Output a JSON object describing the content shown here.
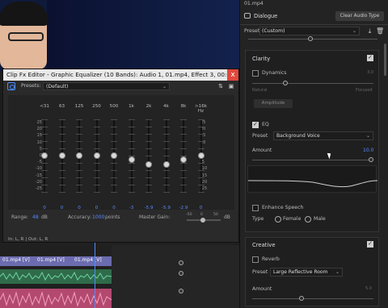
{
  "fx_editor": {
    "title": "Clip Fx Editor - Graphic Equalizer (10 Bands): Audio 1, 01.mp4, Effect 3, 00:00:10:18",
    "close_glyph": "x",
    "presets_label": "Presets:",
    "preset_value": "(Default)",
    "bands": [
      {
        "label": "<31",
        "value": "0",
        "gain_db": 0
      },
      {
        "label": "63",
        "value": "0",
        "gain_db": 0
      },
      {
        "label": "125",
        "value": "0",
        "gain_db": 0
      },
      {
        "label": "250",
        "value": "0",
        "gain_db": 0
      },
      {
        "label": "500",
        "value": "0",
        "gain_db": 0
      },
      {
        "label": "1k",
        "value": "-3",
        "gain_db": -3
      },
      {
        "label": "2k",
        "value": "-5.9",
        "gain_db": -5.9
      },
      {
        "label": "4k",
        "value": "-5.9",
        "gain_db": -5.9
      },
      {
        "label": "8k",
        "value": "-2.9",
        "gain_db": -2.9
      },
      {
        "label": ">16k Hz",
        "value": "0",
        "gain_db": 0
      }
    ],
    "scale_left": [
      "25",
      "20",
      "15",
      "10",
      "5",
      "0",
      "-5",
      "-10",
      "-15",
      "-20",
      "-25"
    ],
    "scale_right": [
      "25",
      "20",
      "15",
      "10",
      "5",
      "0",
      "-5",
      "-10",
      "-15",
      "-20",
      "-25"
    ],
    "range_label": "Range:",
    "range_value": "48",
    "range_unit": "dB",
    "accuracy_label": "Accuracy:",
    "accuracy_value": "1000",
    "accuracy_unit": "points",
    "master_gain_label": "Master Gain:",
    "master_gain_scale": [
      "-50",
      "0",
      "50"
    ],
    "master_gain_unit": "dB",
    "status": "In: L, R | Out: L, R"
  },
  "timeline": {
    "clips": [
      "01.mp4 [V]",
      "01.mp4 [V]",
      "01.mp4 [V]"
    ]
  },
  "essential_sound": {
    "file": "01.mp4",
    "type_label": "Dialogue",
    "clear_button": "Clear Audio Type",
    "preset_label": "Preset:",
    "preset_value": "(Custom)",
    "clarity": {
      "title": "Clarity",
      "dynamics_label": "Dynamics",
      "dynamics_value": "3.0",
      "natural_label": "Natural",
      "focused_label": "Focused",
      "amplitude_button": "Amplitude",
      "eq_label": "EQ",
      "eq_preset_label": "Preset",
      "eq_preset_value": "Background Voice",
      "amount_label": "Amount",
      "amount_value": "10.0",
      "enhance_label": "Enhance Speech",
      "type_label": "Type",
      "female_label": "Female",
      "male_label": "Male"
    },
    "creative": {
      "title": "Creative",
      "reverb_label": "Reverb",
      "preset_label": "Preset",
      "preset_value": "Large Reflective Room",
      "amount_label": "Amount",
      "amount_value": "5.0"
    }
  },
  "colors": {
    "accent": "#5a8bff",
    "close": "#e0483d",
    "video_clip": "#6b6bb0",
    "audio_clip1": "#2f6b4a",
    "audio_clip2": "#b3496e"
  }
}
